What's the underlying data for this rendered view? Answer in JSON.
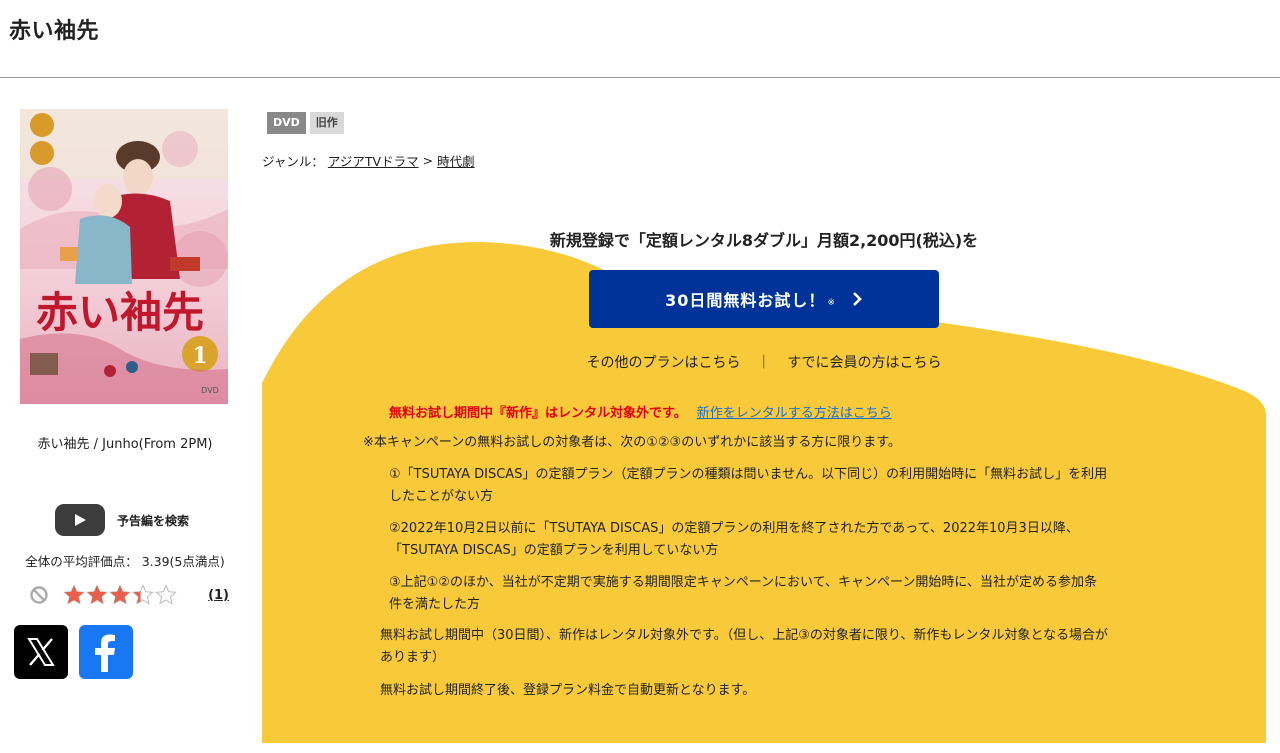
{
  "page_title": "赤い袖先",
  "cover": {
    "title_art": "赤い袖先",
    "vol_label": "1"
  },
  "cover_caption": "赤い袖先 / Junho(From 2PM)",
  "trailer": {
    "label": "予告編を検索"
  },
  "rating": {
    "average_text": "全体の平均評価点： 3.39(5点満点)",
    "average_value": 3.39,
    "max": 5,
    "review_count": "(1)"
  },
  "badges": [
    "DVD",
    "旧作"
  ],
  "genre": {
    "label": "ジャンル：",
    "items": [
      "アジアTVドラマ",
      "時代劇"
    ],
    "separator": ">"
  },
  "promo": {
    "headline": "新規登録で「定額レンタル8ダブル」月額2,200円(税込)を",
    "cta_label": "30日間無料お試し！",
    "cta_note": "※",
    "other_plans": "その他のプランはこちら",
    "separator": "｜",
    "members": "すでに会員の方はこちら",
    "warning": "無料お試し期間中『新作』はレンタル対象外です。",
    "warning_link": "新作をレンタルする方法はこちら",
    "eligibility_intro": "※本キャンペーンの無料お試しの対象者は、次の①②③のいずれかに該当する方に限ります。",
    "conditions": [
      {
        "line1": "①「TSUTAYA DISCAS」の定額プラン（定額プランの種類は問いません。以下同じ）の利用開始時に「無料お試し」を利用",
        "line2": "したことがない方"
      },
      {
        "line1": "②2022年10月2日以前に「TSUTAYA DISCAS」の定額プランの利用を終了された方であって、2022年10月3日以降、",
        "line2": "「TSUTAYA DISCAS」の定額プランを利用していない方"
      },
      {
        "line1": "③上記①②のほか、当社が不定期で実施する期間限定キャンペーンにおいて、キャンペーン開始時に、当社が定める参加条",
        "line2": "件を満たした方"
      }
    ],
    "trial_note_line1": "無料お試し期間中（30日間）、新作はレンタル対象外です。（但し、上記③の対象者に限り、新作もレンタル対象となる場合が",
    "trial_note_line2": "あります）",
    "renewal_note": "無料お試し期間終了後、登録プラン料金で自動更新となります。"
  },
  "colors": {
    "promo_yellow": "#f8ca3a",
    "cta_blue": "#003399",
    "warning_red": "#e60012",
    "link_blue": "#1a6fd1",
    "star_fill": "#e8604c"
  },
  "icons": [
    "youtube-play-icon",
    "prohibited-icon",
    "star-icon",
    "chevron-right-icon",
    "x-logo-icon",
    "facebook-logo-icon"
  ]
}
